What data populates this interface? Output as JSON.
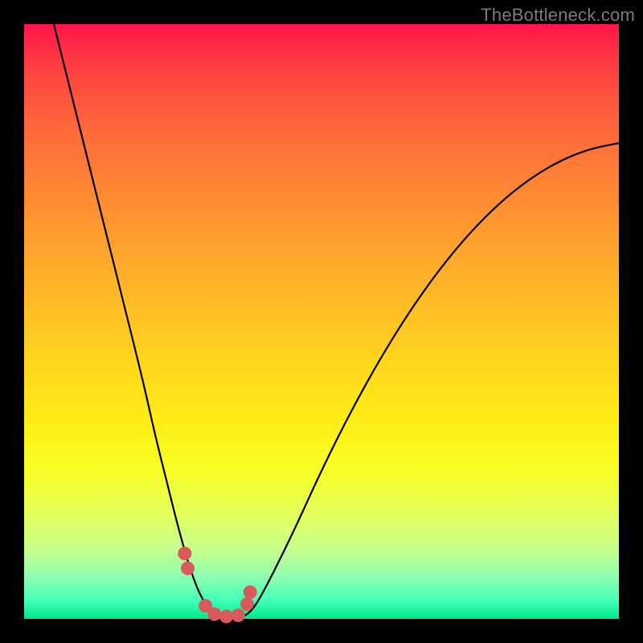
{
  "watermark": "TheBottleneck.com",
  "colors": {
    "background": "#000000",
    "curve_stroke": "#000000",
    "marker_fill": "#d85a5a",
    "gradient_top": "#ff154a",
    "gradient_bottom": "#00e888"
  },
  "chart_data": {
    "type": "line",
    "title": "",
    "xlabel": "",
    "ylabel": "",
    "xlim": [
      0,
      100
    ],
    "ylim": [
      0,
      100
    ],
    "series": [
      {
        "name": "bottleneck-curve",
        "x": [
          5,
          10,
          15,
          20,
          22,
          24,
          26,
          28,
          30,
          32,
          34,
          36,
          38,
          40,
          45,
          50,
          55,
          60,
          65,
          70,
          75,
          80,
          85,
          90,
          95,
          100
        ],
        "values": [
          100,
          80,
          60,
          40,
          31,
          23,
          15,
          8,
          3,
          1,
          0,
          0,
          1,
          4,
          14,
          25,
          35,
          44,
          52,
          59,
          65,
          70,
          74,
          77,
          79,
          80
        ]
      }
    ],
    "markers": {
      "name": "highlighted-points",
      "x": [
        27,
        27.5,
        30.5,
        32,
        34,
        36,
        37.5,
        38
      ],
      "values": [
        11,
        8.5,
        2.2,
        0.8,
        0.4,
        0.6,
        2.5,
        4.5
      ]
    }
  }
}
